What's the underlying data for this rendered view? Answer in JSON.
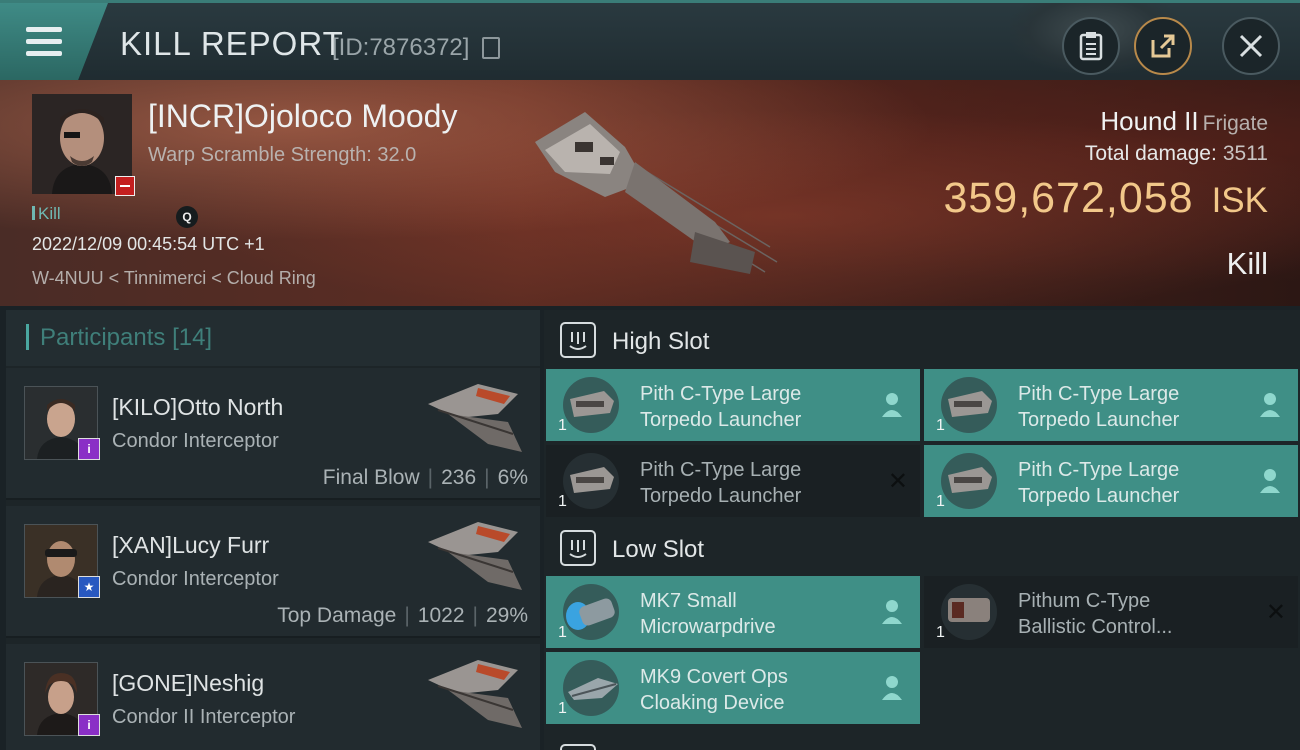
{
  "header": {
    "title": "KILL REPORT",
    "report_id": "[ID:7876372]"
  },
  "victim": {
    "name": "[INCR]Ojoloco Moody",
    "subtitle": "Warp Scramble Strength: 32.0",
    "tag": "Kill",
    "time": "2022/12/09 00:45:54 UTC +1",
    "location": "W-4NUU < Tinnimerci < Cloud Ring",
    "ship_name": "Hound II",
    "ship_class": "Frigate",
    "damage_label": "Total damage:",
    "damage_value": "3511",
    "isk_value": "359,672,058",
    "isk_unit": "ISK",
    "result": "Kill"
  },
  "participants": {
    "title": "Participants",
    "count": "[14]",
    "rows": [
      {
        "name": "[KILO]Otto North",
        "ship": "Condor Interceptor",
        "role": "Final Blow",
        "damage": "236",
        "percent": "6%",
        "badge": "i"
      },
      {
        "name": "[XAN]Lucy Furr",
        "ship": "Condor Interceptor",
        "role": "Top Damage",
        "damage": "1022",
        "percent": "29%",
        "badge": "★"
      },
      {
        "name": "[GONE]Neshig",
        "ship": "Condor II Interceptor",
        "role": "",
        "damage": "",
        "percent": "",
        "badge": "i"
      }
    ]
  },
  "high_slot": {
    "title": "High Slot",
    "modules": [
      {
        "line1": "Pith C-Type Large",
        "line2": "Torpedo Launcher",
        "qty": "1",
        "state": "dropped"
      },
      {
        "line1": "Pith C-Type Large",
        "line2": "Torpedo Launcher",
        "qty": "1",
        "state": "dropped"
      },
      {
        "line1": "Pith C-Type Large",
        "line2": "Torpedo Launcher",
        "qty": "1",
        "state": "destroyed"
      },
      {
        "line1": "Pith C-Type Large",
        "line2": "Torpedo Launcher",
        "qty": "1",
        "state": "dropped"
      }
    ]
  },
  "low_slot": {
    "title": "Low Slot",
    "modules": [
      {
        "line1": "MK7 Small",
        "line2": "Microwarpdrive",
        "qty": "1",
        "state": "dropped"
      },
      {
        "line1": "Pithum C-Type",
        "line2": "Ballistic Control...",
        "qty": "1",
        "state": "destroyed"
      },
      {
        "line1": "MK9 Covert Ops",
        "line2": "Cloaking Device",
        "qty": "1",
        "state": "dropped"
      }
    ]
  },
  "colors": {
    "accent_teal": "#3f8f86",
    "isk_gold": "#f2c88a",
    "victim_red": "#c41f1f"
  }
}
